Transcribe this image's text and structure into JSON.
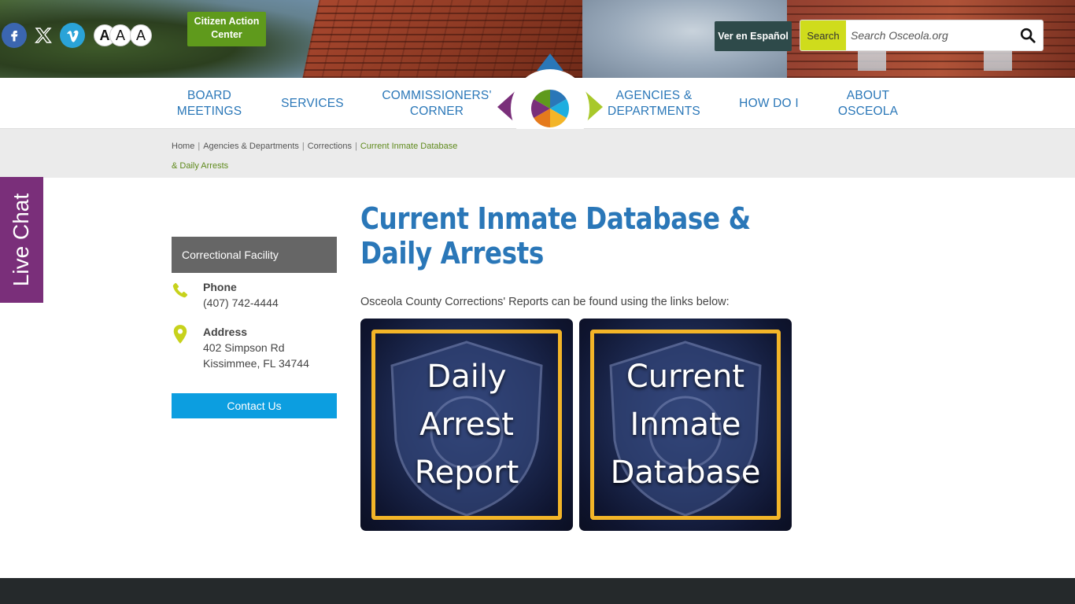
{
  "header": {
    "social": {
      "facebook": "facebook-icon",
      "x": "x-icon",
      "vimeo": "vimeo-icon"
    },
    "font_sizes": [
      "A",
      "A",
      "A"
    ],
    "citizen_action_center": "Citizen Action Center",
    "espanol": "Ver en Español",
    "search": {
      "label": "Search",
      "placeholder": "Search Osceola.org",
      "icon": "search-icon"
    }
  },
  "nav": {
    "items": [
      {
        "label": "BOARD MEETINGS"
      },
      {
        "label": "SERVICES"
      },
      {
        "label": "COMMISSIONERS' CORNER"
      },
      {
        "label": "AGENCIES & DEPARTMENTS"
      },
      {
        "label": "HOW DO I"
      },
      {
        "label": "ABOUT OSCEOLA"
      }
    ]
  },
  "breadcrumb": {
    "items": [
      "Home",
      "Agencies & Departments",
      "Corrections"
    ],
    "current": "Current Inmate Database & Daily Arrests"
  },
  "live_chat": "Live Chat",
  "sidebar": {
    "heading": "Correctional Facility",
    "phone_label": "Phone",
    "phone": "(407) 742-4444",
    "address_label": "Address",
    "address_line1": "402 Simpson Rd",
    "address_line2": "Kissimmee, FL 34744",
    "contact_button": "Contact Us"
  },
  "main": {
    "title": "Current Inmate Database & Daily Arrests",
    "intro": "Osceola County Corrections' Reports can be found using the links below:",
    "tiles": [
      {
        "lines": [
          "Daily",
          "Arrest",
          "Report"
        ]
      },
      {
        "lines": [
          "Current",
          "Inmate",
          "Database"
        ]
      }
    ]
  },
  "colors": {
    "brand_blue": "#2a77b8",
    "cac_green": "#5f9a1c",
    "search_yellow": "#cfdc1c",
    "live_chat_purple": "#7a2f7a",
    "contact_blue": "#0c9ee0",
    "tile_frame": "#f3b528"
  }
}
